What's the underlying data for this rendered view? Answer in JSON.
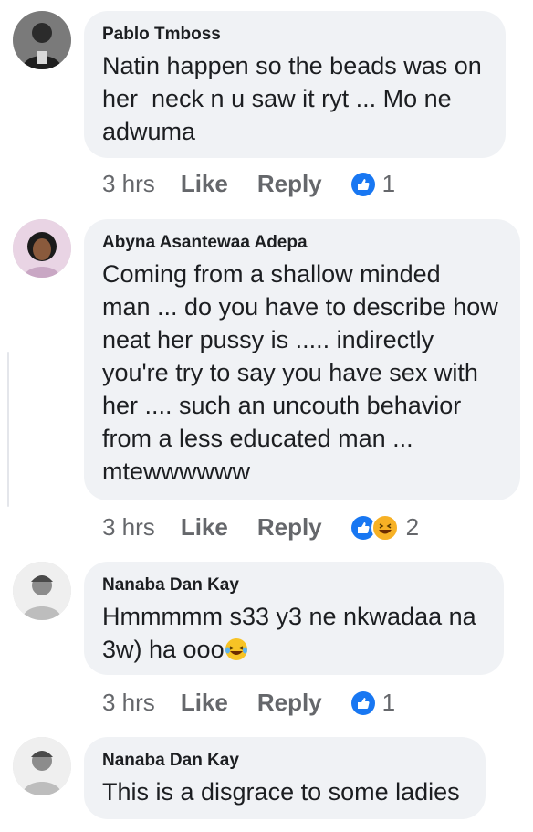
{
  "comments": [
    {
      "name": "Pablo Tmboss",
      "text": "Natin happen so the beads was on\nher  neck n u saw it ryt ... Mo ne\nadwuma",
      "time": "3 hrs",
      "like_label": "Like",
      "reply_label": "Reply",
      "reactions": [
        "like-icon"
      ],
      "reaction_count": "1"
    },
    {
      "name": "Abyna Asantewaa  Adepa",
      "text": "Coming from a shallow minded\nman ... do you have to describe how\nneat her pussy is ..... indirectly\nyou're try to say you have sex with\nher .... such an uncouth behavior\nfrom a less educated man ...\nmtewwwwww",
      "time": "3 hrs",
      "like_label": "Like",
      "reply_label": "Reply",
      "reactions": [
        "like-icon",
        "haha-icon"
      ],
      "reaction_count": "2"
    },
    {
      "name": "Nanaba Dan Kay",
      "text": "Hmmmmm s33 y3 ne nkwadaa na\n3w) ha ooo",
      "text_emoji": "laughing-tears-emoji",
      "time": "3 hrs",
      "like_label": "Like",
      "reply_label": "Reply",
      "reactions": [
        "like-icon"
      ],
      "reaction_count": "1"
    },
    {
      "name": "Nanaba Dan Kay",
      "text": "This is a disgrace to some ladies"
    }
  ],
  "colors": {
    "bubble": "#f0f2f5",
    "meta_text": "#65676b",
    "like_blue": "#1877f2",
    "haha_yellow": "#f7b125"
  }
}
